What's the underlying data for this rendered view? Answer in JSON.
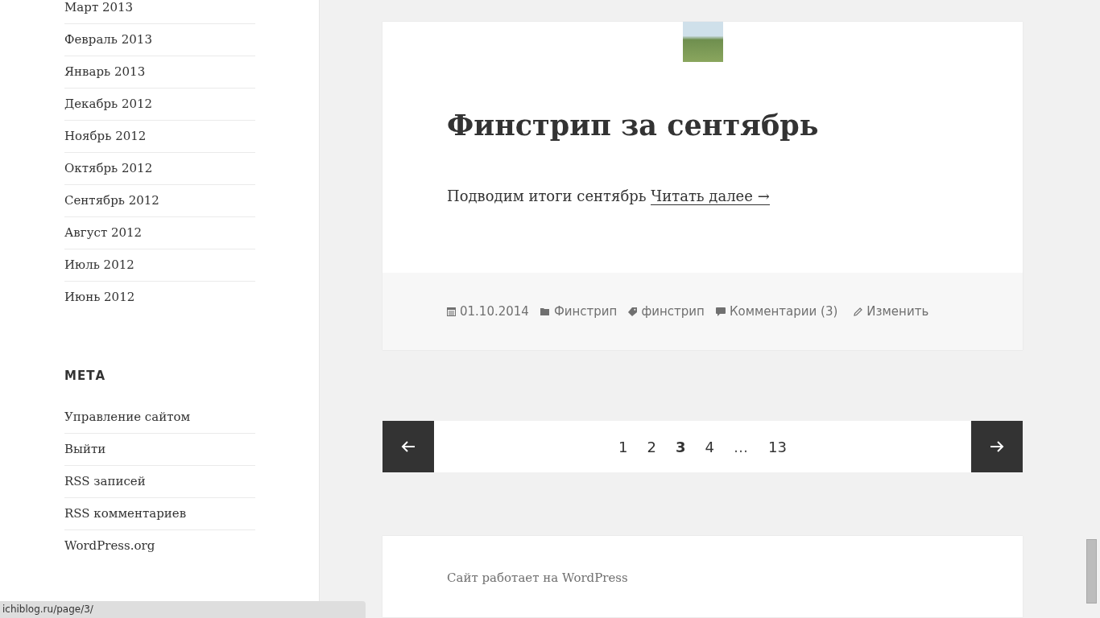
{
  "sidebar": {
    "archive_items": [
      "Март 2013",
      "Февраль 2013",
      "Январь 2013",
      "Декабрь 2012",
      "Ноябрь 2012",
      "Октябрь 2012",
      "Сентябрь 2012",
      "Август 2012",
      "Июль 2012",
      "Июнь 2012"
    ],
    "meta_heading": "МЕТА",
    "meta_links": [
      "Управление сайтом",
      "Выйти",
      "RSS записей",
      "RSS комментариев",
      "WordPress.org"
    ]
  },
  "post": {
    "title": "Финстрип за сентябрь",
    "excerpt": "Подводим итоги сентябрь",
    "read_more": "Читать далее →",
    "meta": {
      "date": "01.10.2014",
      "category": "Финстрип",
      "tag": "финстрип",
      "comments": "Комментарии (3)",
      "edit": "Изменить"
    }
  },
  "pagination": {
    "pages": [
      {
        "label": "1",
        "kind": "page",
        "selected": false
      },
      {
        "label": "2",
        "kind": "page",
        "selected": false
      },
      {
        "label": "3",
        "kind": "page",
        "selected": true
      },
      {
        "label": "4",
        "kind": "page",
        "selected": false
      },
      {
        "label": "…",
        "kind": "dots",
        "selected": false
      },
      {
        "label": "13",
        "kind": "page",
        "selected": false
      }
    ]
  },
  "footer": {
    "credit": "Сайт работает на WordPress"
  },
  "status_bar": {
    "url": "ichiblog.ru/page/3/"
  }
}
